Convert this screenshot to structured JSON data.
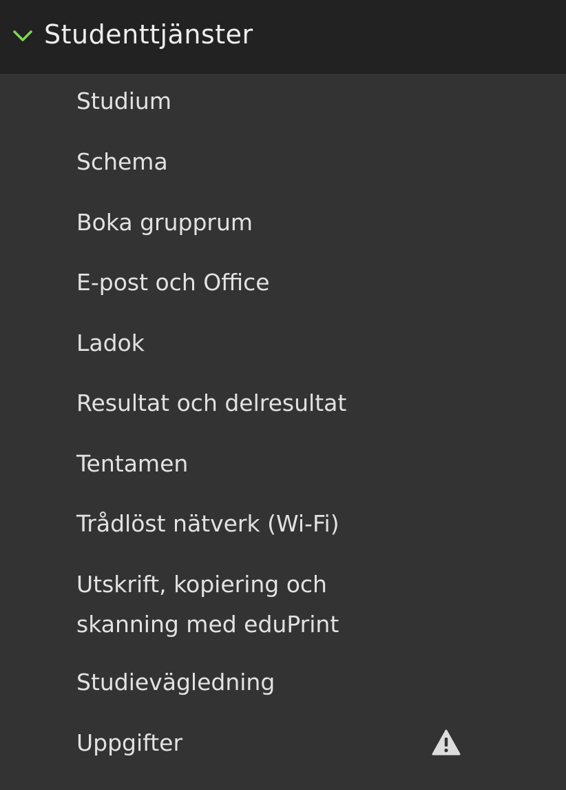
{
  "section": {
    "title": "Studenttjänster",
    "expanded": true,
    "chevron_icon": "chevron-down-icon",
    "chevron_color": "#7ed957"
  },
  "items": [
    {
      "label": "Studium"
    },
    {
      "label": "Schema"
    },
    {
      "label": "Boka grupprum"
    },
    {
      "label": "E-post och Office"
    },
    {
      "label": "Ladok"
    },
    {
      "label": "Resultat och delresultat"
    },
    {
      "label": "Tentamen"
    },
    {
      "label": "Trådlöst nätverk (Wi-Fi)"
    },
    {
      "label_line1": "Utskrift, kopiering och",
      "label_line2": "skanning med eduPrint"
    },
    {
      "label": "Studievägledning"
    },
    {
      "label": "Uppgifter",
      "icon": "warning-icon"
    }
  ],
  "colors": {
    "header_bg": "#222222",
    "list_bg": "#333333",
    "text": "#e2e2e2",
    "warning_icon": "#dddddd"
  }
}
